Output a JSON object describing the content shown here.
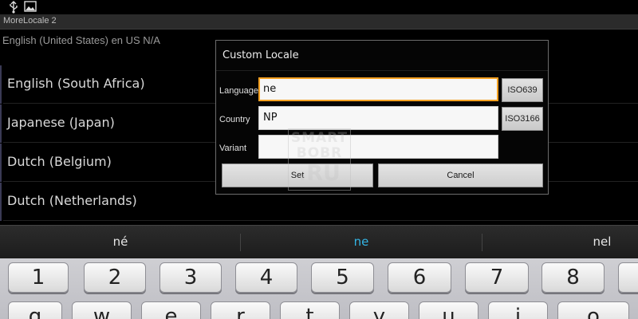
{
  "status_bar": {
    "icons": [
      "usb-icon",
      "image-icon"
    ]
  },
  "app": {
    "title": "MoreLocale 2"
  },
  "current_locale": "English (United States)   en US N/A",
  "locale_list": [
    "English (South Africa)",
    "Japanese (Japan)",
    "Dutch (Belgium)",
    "Dutch (Netherlands)"
  ],
  "dialog": {
    "title": "Custom Locale",
    "language_label": "Language",
    "language_value": "ne",
    "country_label": "Country",
    "country_value": "NP",
    "variant_label": "Variant",
    "variant_value": "",
    "iso639_button": "ISO639",
    "iso3166_button": "ISO3166",
    "set_button": "Set",
    "cancel_button": "Cancel"
  },
  "watermark": {
    "line1": "SMART",
    "line2": "BOBR",
    "line3": ".RU"
  },
  "suggestions": [
    "né",
    "ne",
    "nel"
  ],
  "keyboard": {
    "number_row": [
      "1",
      "2",
      "3",
      "4",
      "5",
      "6",
      "7",
      "8"
    ],
    "letter_row": [
      "q",
      "w",
      "e",
      "r",
      "t",
      "y",
      "u",
      "i",
      "o"
    ]
  },
  "colors": {
    "focus": "#f5a020",
    "suggestion_primary": "#33b5e5"
  }
}
